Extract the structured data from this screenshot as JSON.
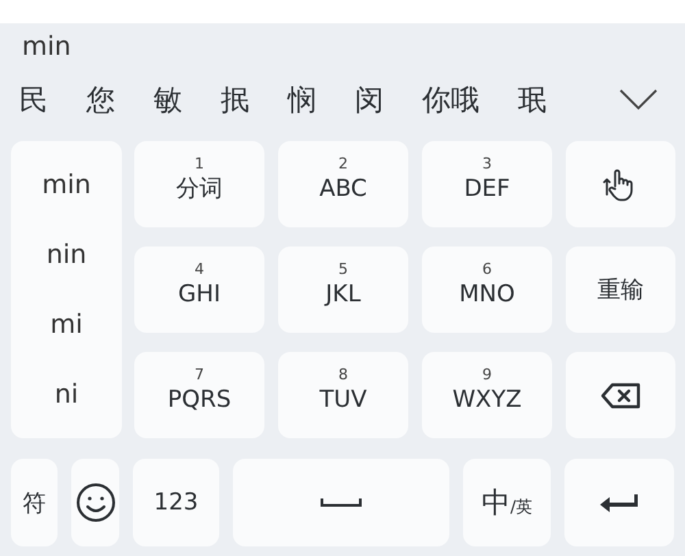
{
  "composition": "min",
  "candidates": [
    "民",
    "您",
    "敏",
    "抿",
    "悯",
    "闵",
    "你哦",
    "珉"
  ],
  "pinyin_list": [
    "min",
    "nin",
    "mi",
    "ni"
  ],
  "keys": [
    {
      "number": "1",
      "label": "分词"
    },
    {
      "number": "2",
      "label": "ABC"
    },
    {
      "number": "3",
      "label": "DEF"
    },
    {
      "number": "4",
      "label": "GHI"
    },
    {
      "number": "5",
      "label": "JKL"
    },
    {
      "number": "6",
      "label": "MNO"
    },
    {
      "number": "7",
      "label": "PQRS"
    },
    {
      "number": "8",
      "label": "TUV"
    },
    {
      "number": "9",
      "label": "WXYZ"
    }
  ],
  "side_keys": [
    {
      "kind": "gesture"
    },
    {
      "kind": "text",
      "label": "重输"
    },
    {
      "kind": "backspace"
    }
  ],
  "bottom_keys": [
    {
      "kind": "text",
      "label": "符"
    },
    {
      "kind": "emoji"
    },
    {
      "kind": "text",
      "label": "123"
    },
    {
      "kind": "space"
    },
    {
      "kind": "lang",
      "main": "中",
      "sub": "/英"
    },
    {
      "kind": "enter"
    }
  ]
}
